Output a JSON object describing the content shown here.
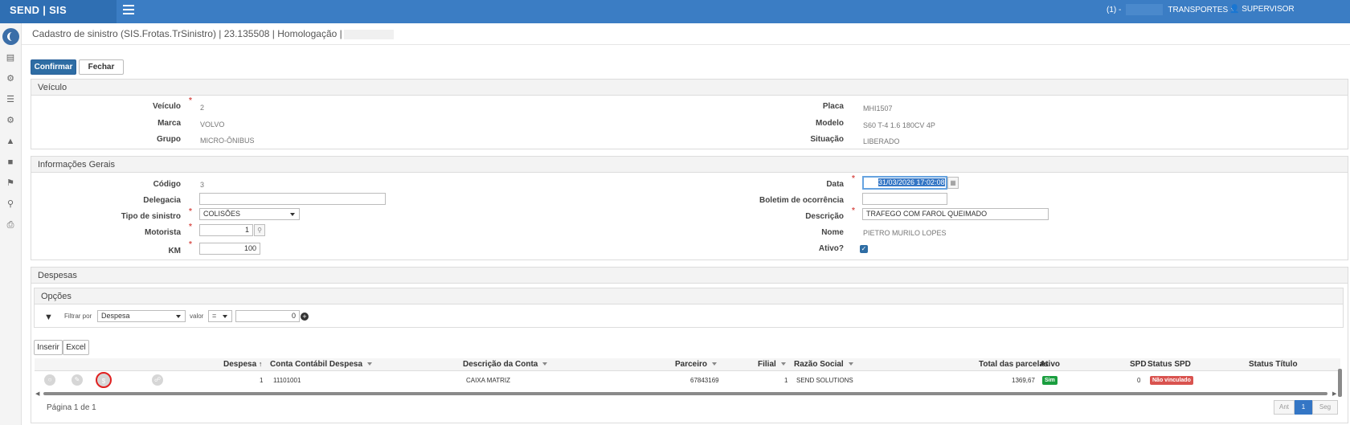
{
  "topbar": {
    "brand": "SEND | SIS",
    "company_prefix": "(1) -",
    "company": "TRANSPORTES",
    "user": "SUPERVISOR (SUPERVISOR)"
  },
  "page": {
    "title": "Cadastro de sinistro (SIS.Frotas.TrSinistro) | 23.135508 | Homologação |"
  },
  "actions": {
    "confirm": "Confirmar",
    "close": "Fechar"
  },
  "veiculo": {
    "section": "Veículo",
    "veiculo_label": "Veículo",
    "veiculo": "2",
    "marca_label": "Marca",
    "marca": "VOLVO",
    "grupo_label": "Grupo",
    "grupo": "MICRO-ÔNIBUS",
    "placa_label": "Placa",
    "placa": "MHI1507",
    "modelo_label": "Modelo",
    "modelo": "S60 T-4 1.6 180CV 4P",
    "situacao_label": "Situação",
    "situacao": "LIBERADO"
  },
  "geral": {
    "section": "Informações Gerais",
    "codigo_label": "Código",
    "codigo": "3",
    "delegacia_label": "Delegacia",
    "delegacia": "",
    "tipo_label": "Tipo de sinistro",
    "tipo": "COLISÕES",
    "motorista_label": "Motorista",
    "motorista": "1",
    "km_label": "KM",
    "km": "100",
    "data_label": "Data",
    "data": "31/03/2026 17:02:08",
    "boletim_label": "Boletim de ocorrência",
    "boletim": "",
    "descricao_label": "Descrição",
    "descricao": "TRAFEGO COM FAROL QUEIMADO",
    "nome_label": "Nome",
    "nome": "PIETRO MURILO LOPES",
    "ativo_label": "Ativo?"
  },
  "despesas": {
    "section": "Despesas",
    "options_title": "Opções",
    "filter_label": "Filtrar por",
    "filter_field": "Despesa",
    "valor_label": "valor",
    "operator": "=",
    "filter_value": "0",
    "insert": "Inserir",
    "excel": "Excel",
    "columns": {
      "despesa": "Despesa",
      "conta": "Conta Contábil Despesa",
      "descricao": "Descrição da Conta",
      "parceiro": "Parceiro",
      "filial": "Filial",
      "razao": "Razão Social",
      "total": "Total das parcelas",
      "ativo": "Ativo",
      "spd": "SPD",
      "status_spd": "Status SPD",
      "status_titulo": "Status Título"
    },
    "rows": [
      {
        "despesa": "1",
        "conta": "11101001",
        "descricao": "CAIXA MATRIZ",
        "parceiro": "67843169",
        "filial": "1",
        "razao": "SEND SOLUTIONS",
        "total": "1369,67",
        "ativo": "Sim",
        "spd": "0",
        "status_spd": "Não vinculado"
      }
    ],
    "pagination": {
      "text": "Página 1 de 1",
      "prev": "Ant",
      "current": "1",
      "next": "Seg"
    }
  },
  "colors": {
    "topbar": "#3b7dc4",
    "primary": "#2e6da4",
    "required": "#d9534f",
    "badge_yes": "#1a9e3f",
    "badge_no": "#d9534f"
  }
}
